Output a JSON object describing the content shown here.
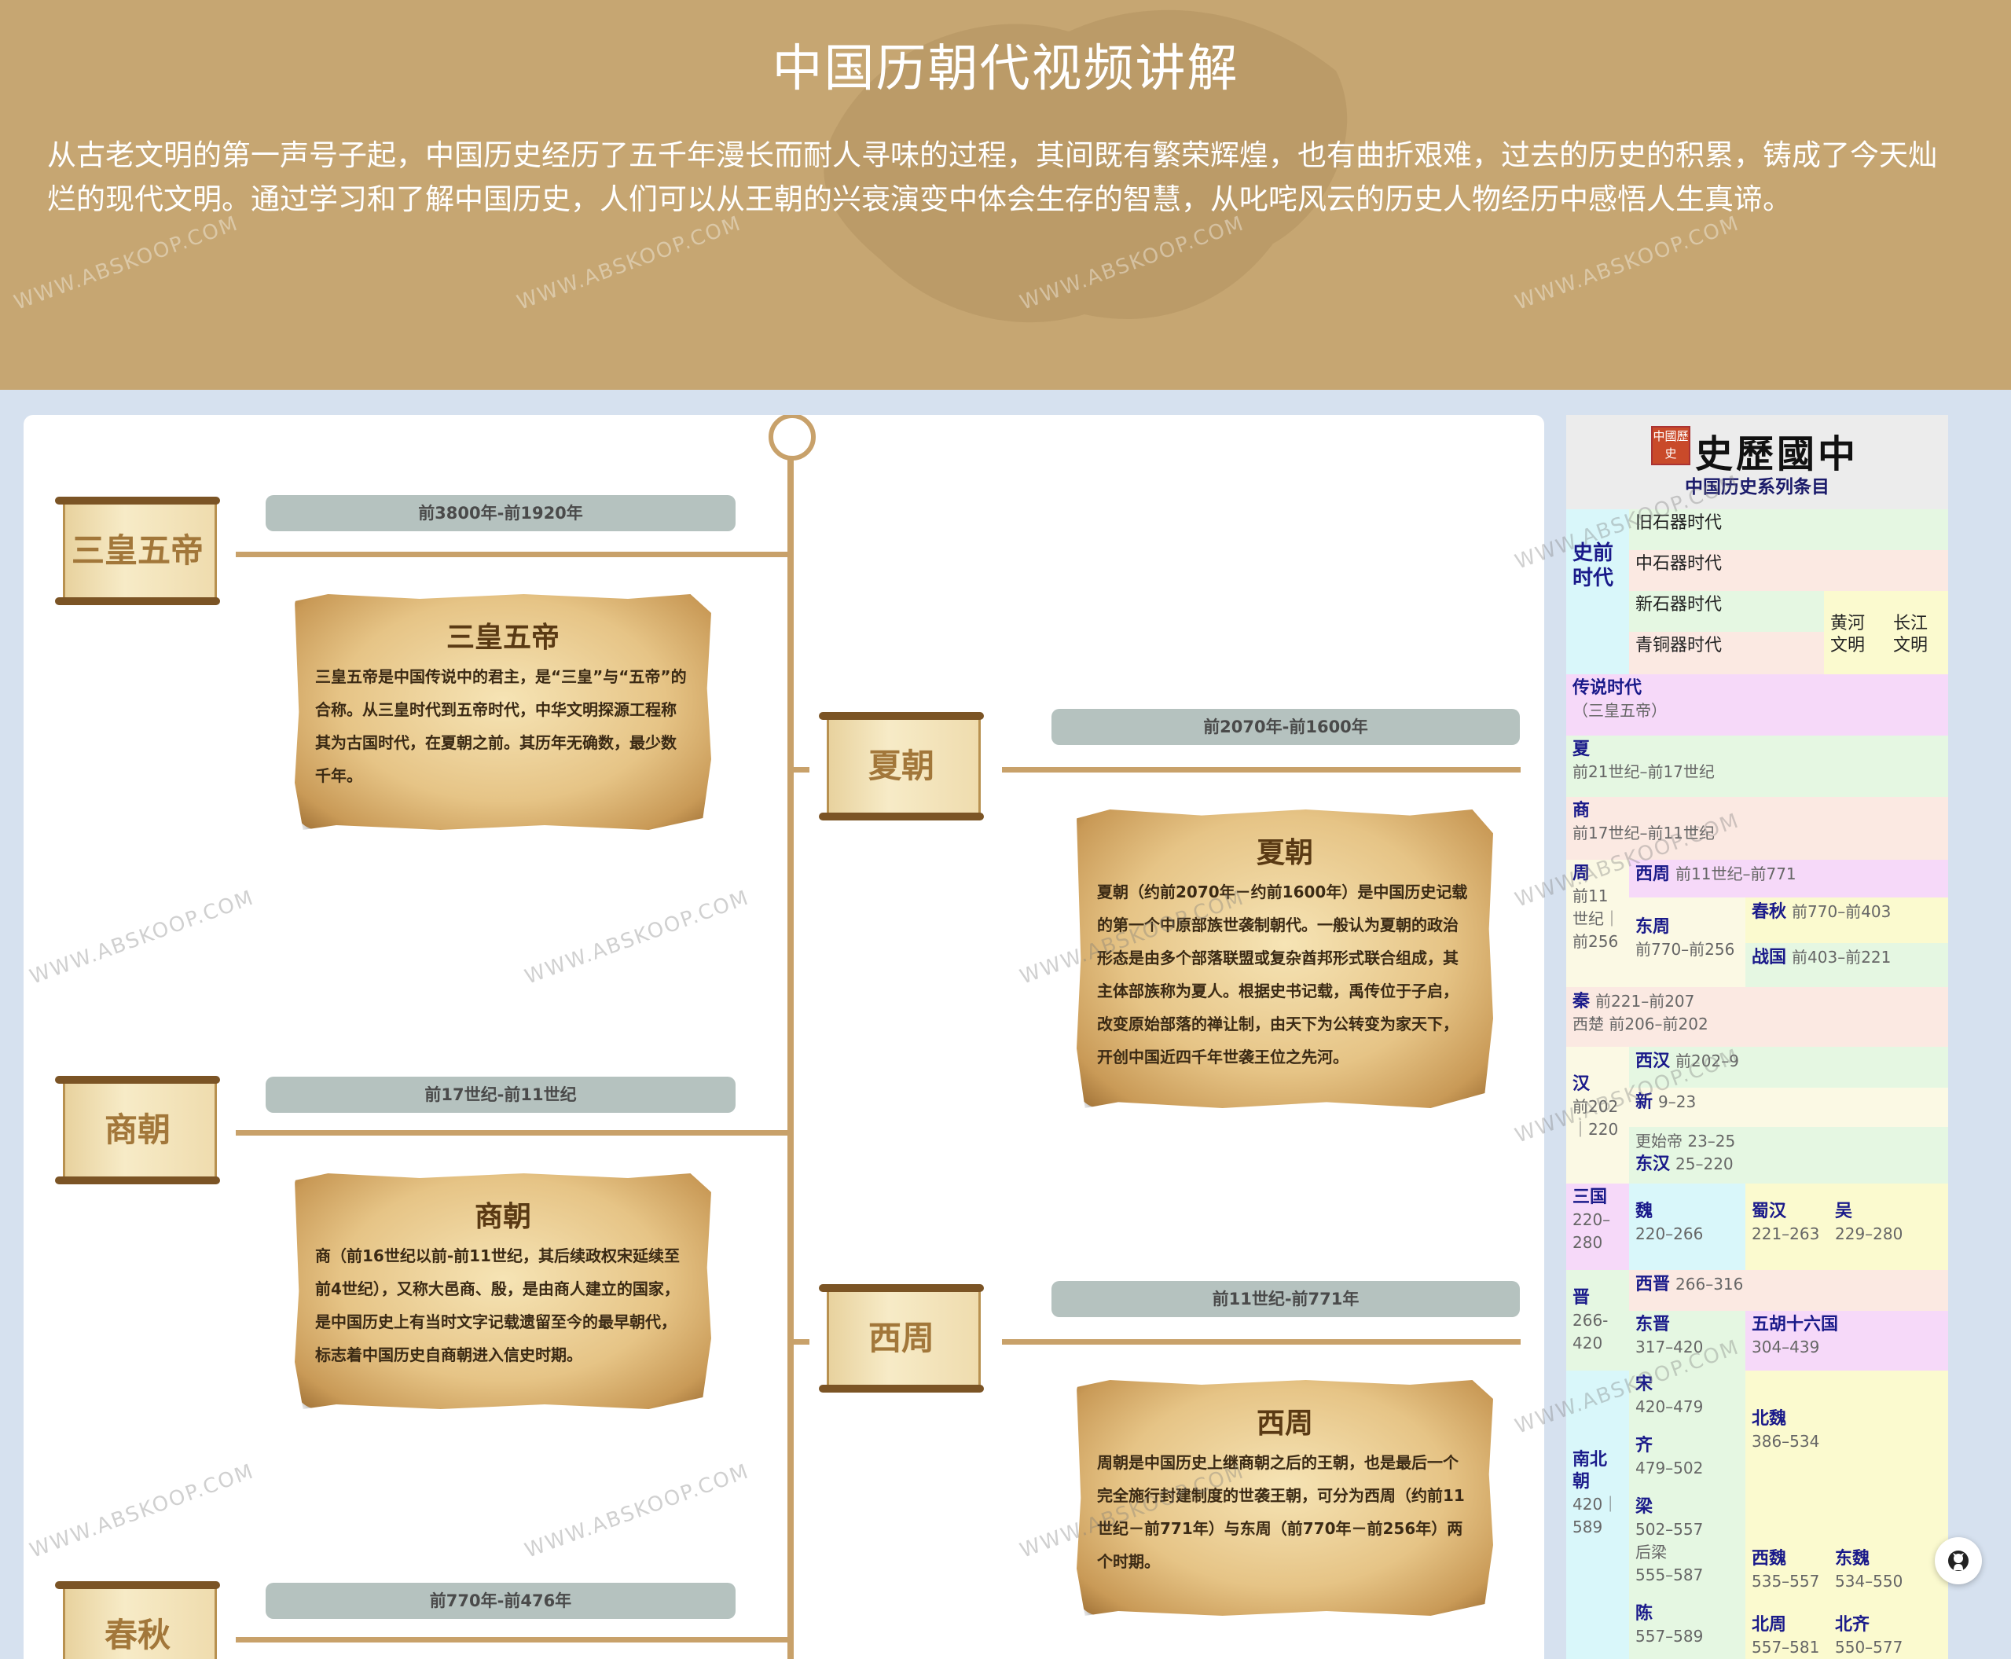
{
  "header": {
    "title": "中国历朝代视频讲解",
    "intro": "从古老文明的第一声号子起，中国历史经历了五千年漫长而耐人寻味的过程，其间既有繁荣辉煌，也有曲折艰难，过去的历史的积累，铸成了今天灿烂的现代文明。通过学习和了解中国历史，人们可以从王朝的兴衰演变中体会生存的智慧，从叱咤风云的历史人物经历中感悟人生真谛。"
  },
  "watermark": "WWW.ABSKOOP.COM",
  "timeline": [
    {
      "name": "三皇五帝",
      "date": "前3800年-前1920年",
      "card_title": "三皇五帝",
      "card_text": "三皇五帝是中国传说中的君主，是“三皇”与“五帝”的合称。从三皇时代到五帝时代，中华文明探源工程称其为古国时代，在夏朝之前。其历年无确数，最少数千年。"
    },
    {
      "name": "夏朝",
      "date": "前2070年-前1600年",
      "card_title": "夏朝",
      "card_text": "夏朝（约前2070年－约前1600年）是中国历史记载的第一个中原部族世袭制朝代。一般认为夏朝的政治形态是由多个部落联盟或复杂酋邦形式联合组成，其主体部族称为夏人。根据史书记载，禹传位于子启，改变原始部落的禅让制，由天下为公转变为家天下，开创中国近四千年世袭王位之先河。"
    },
    {
      "name": "商朝",
      "date": "前17世纪-前11世纪",
      "card_title": "商朝",
      "card_text": "商（前16世纪以前-前11世纪，其后续政权宋延续至前4世纪），又称大邑商、殷，是由商人建立的国家，是中国历史上有当时文字记载遗留至今的最早朝代，标志着中国历史自商朝进入信史时期。"
    },
    {
      "name": "西周",
      "date": "前11世纪-前771年",
      "card_title": "西周",
      "card_text": "周朝是中国历史上继商朝之后的王朝，也是最后一个完全施行封建制度的世袭王朝，可分为西周（约前11世纪－前771年）与东周（前770年－前256年）两个时期。"
    },
    {
      "name": "春秋",
      "date": "前770年-前476年"
    }
  ],
  "sidebar": {
    "brand": "史歷國中",
    "seal": "中國歷史",
    "subtitle": "中国历史系列条目",
    "prehistory_label": "史前时代",
    "paleolithic": "旧石器时代",
    "mesolithic": "中石器时代",
    "neolithic": "新石器时代",
    "bronze": "青铜器时代",
    "yellow_river": "黄河文明",
    "yangtze": "长江文明",
    "legend": "传说时代",
    "legend_sub": "（三皇五帝）",
    "xia": "夏",
    "xia_date": "前21世纪–前17世纪",
    "shang": "商",
    "shang_date": "前17世纪–前11世纪",
    "zhou": "周",
    "zhou_date": "前11世纪｜前256",
    "western_zhou": "西周",
    "western_zhou_date": "前11世纪–前771",
    "eastern_zhou": "东周",
    "eastern_zhou_date": "前770–前256",
    "spring_autumn": "春秋",
    "spring_autumn_date": "前770–前403",
    "warring": "战国",
    "warring_date": "前403–前221",
    "qin": "秦",
    "qin_date": "前221–前207",
    "western_chu": "西楚 前206–前202",
    "han": "汉",
    "han_date": "前202｜220",
    "western_han": "西汉",
    "western_han_date": "前202–9",
    "xin": "新",
    "xin_date": "9–23",
    "gengshi": "更始帝 23–25",
    "eastern_han": "东汉",
    "eastern_han_date": "25–220",
    "three_kingdoms": "三国",
    "three_kingdoms_date": "220–280",
    "wei": "魏",
    "wei_date": "220–266",
    "shu": "蜀汉",
    "shu_date": "221–263",
    "wu": "吴",
    "wu_date": "229–280",
    "jin": "晋",
    "jin_date": "266-420",
    "western_jin": "西晋",
    "western_jin_date": "266–316",
    "eastern_jin": "东晋",
    "eastern_jin_date": "317–420",
    "sixteen": "五胡十六国",
    "sixteen_date": "304–439",
    "nanbei": "南北朝",
    "nanbei_date": "420｜589",
    "song": "宋",
    "song_date": "420–479",
    "qi": "齐",
    "qi_date": "479–502",
    "liang": "梁",
    "liang_date": "502–557",
    "later_liang": "后梁",
    "later_liang_date": "555–587",
    "chen": "陈",
    "chen_date": "557–589",
    "northern_wei": "北魏",
    "northern_wei_date": "386–534",
    "western_wei": "西魏",
    "western_wei_date": "535–557",
    "eastern_wei": "东魏",
    "eastern_wei_date": "534–550",
    "northern_zhou": "北周",
    "northern_zhou_date": "557–581",
    "northern_qi": "北齐",
    "northern_qi_date": "550–577"
  },
  "colors": {
    "header_bg": "#c6a672",
    "page_bg": "#d6e1ef",
    "timeline": "#c8a16a",
    "date_bar": "#b5c2bf"
  },
  "icons": {
    "github": "github-icon",
    "scroll": "scroll-icon"
  }
}
